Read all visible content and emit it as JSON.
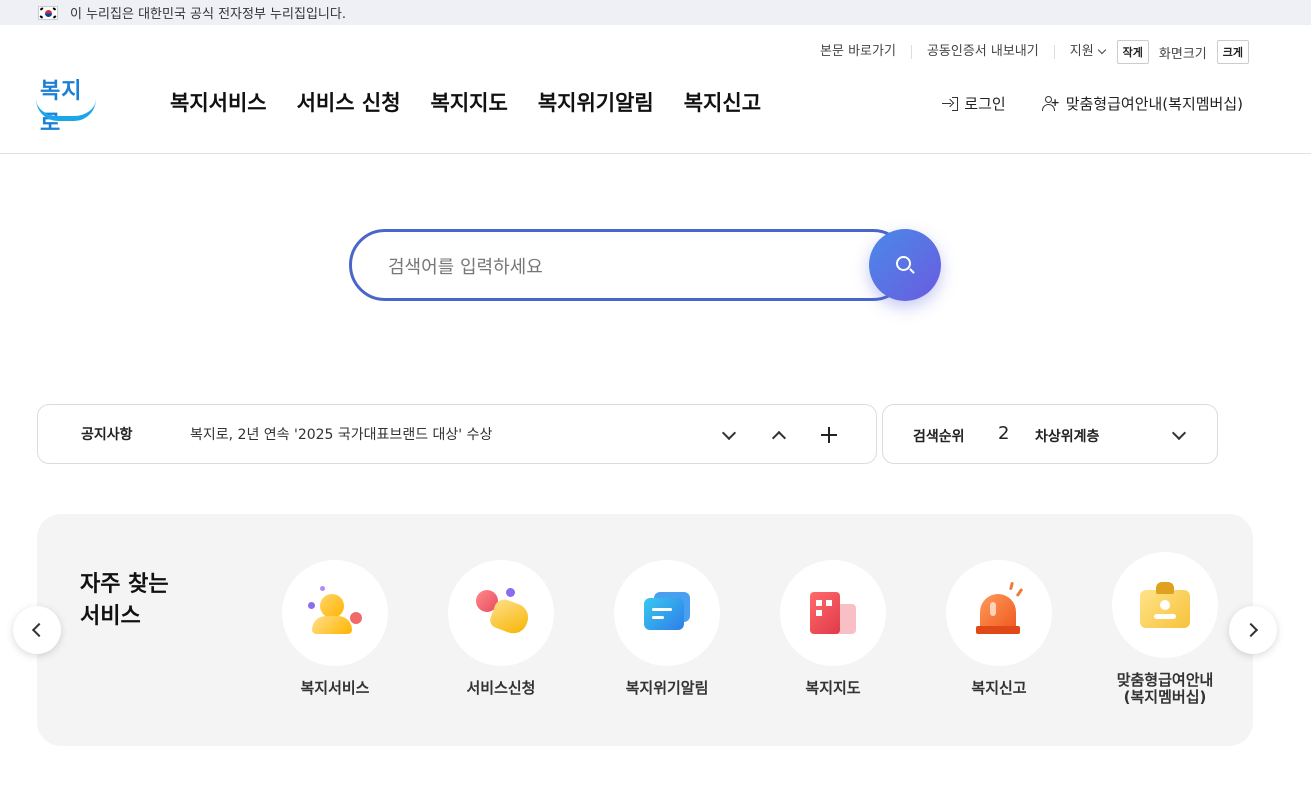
{
  "gov_banner": {
    "text": "이 누리집은 대한민국 공식 전자정부 누리집입니다."
  },
  "utility": {
    "skip_link": "본문 바로가기",
    "cert_export": "공동인증서 내보내기",
    "support": "지원",
    "font_small": "작게",
    "font_size_label": "화면크기",
    "font_large": "크게"
  },
  "logo": {
    "text": "복지로"
  },
  "gnb": [
    "복지서비스",
    "서비스 신청",
    "복지지도",
    "복지위기알림",
    "복지신고"
  ],
  "member": {
    "login": "로그인",
    "membership": "맞춤형급여안내(복지멤버십)"
  },
  "search": {
    "placeholder": "검색어를 입력하세요"
  },
  "notice": {
    "label": "공지사항",
    "text": "복지로, 2년 연속 '2025 국가대표브랜드 대상' 수상"
  },
  "ranking": {
    "label": "검색순위",
    "rank": "2",
    "term": "차상위계층"
  },
  "frequent": {
    "title_line1": "자주 찾는",
    "title_line2": "서비스",
    "items": [
      {
        "label": "복지서비스",
        "icon": "person-icon"
      },
      {
        "label": "서비스신청",
        "icon": "hand-click-icon"
      },
      {
        "label": "복지위기알림",
        "icon": "message-icon"
      },
      {
        "label": "복지지도",
        "icon": "building-icon"
      },
      {
        "label": "복지신고",
        "icon": "siren-icon"
      },
      {
        "label": "맞춤형급여안내\n(복지멤버십)",
        "icon": "id-card-icon"
      }
    ]
  },
  "colors": {
    "accent": "#4a66c8",
    "logo_blue": "#1c7fd6",
    "panel_bg": "#f4f4f5"
  }
}
